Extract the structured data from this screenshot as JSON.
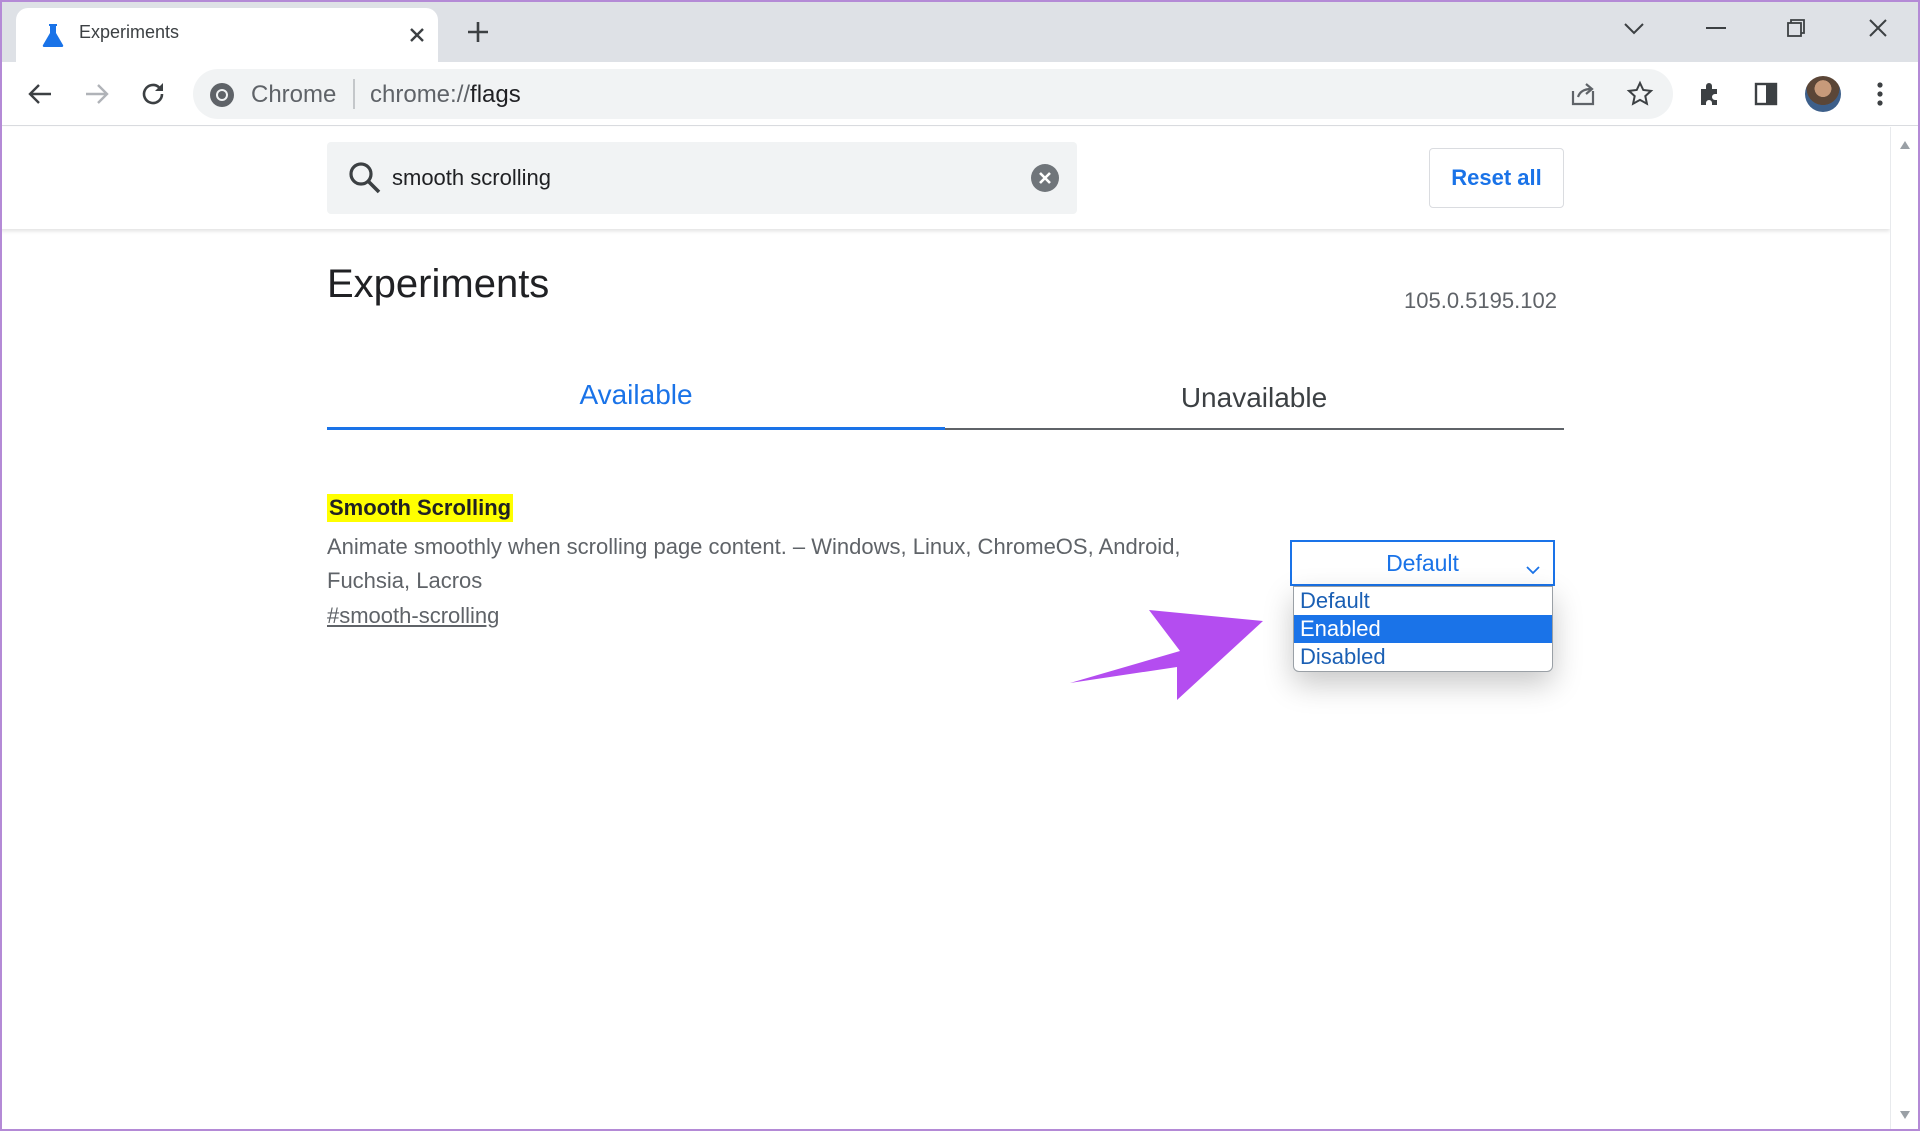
{
  "window": {
    "tab_title": "Experiments",
    "icons": {
      "favicon": "flask-icon",
      "tab_close": "close-icon",
      "new_tab": "plus-icon",
      "tab_search": "chevron-down-icon",
      "minimize": "minimize-icon",
      "restore": "restore-icon",
      "close": "close-icon"
    }
  },
  "toolbar": {
    "omnibox_label": "Chrome",
    "url_scheme": "chrome://",
    "url_path": "flags",
    "icons": [
      "back-icon",
      "forward-icon",
      "reload-icon",
      "share-icon",
      "star-icon",
      "extensions-icon",
      "side-panel-icon",
      "avatar",
      "more-vert-icon"
    ]
  },
  "search": {
    "value": "smooth scrolling",
    "reset_label": "Reset all"
  },
  "page": {
    "title": "Experiments",
    "version": "105.0.5195.102",
    "tabs": [
      {
        "label": "Available",
        "active": true
      },
      {
        "label": "Unavailable",
        "active": false
      }
    ]
  },
  "flag": {
    "name": "Smooth Scrolling",
    "description": "Animate smoothly when scrolling page content. – Windows, Linux, ChromeOS, Android, Fuchsia, Lacros",
    "link": "#smooth-scrolling",
    "select_value": "Default",
    "options": [
      "Default",
      "Enabled",
      "Disabled"
    ],
    "highlighted_option": "Enabled"
  },
  "colors": {
    "accent": "#1a73e8",
    "highlight": "#ffff00",
    "annotation_arrow": "#b44df0"
  }
}
